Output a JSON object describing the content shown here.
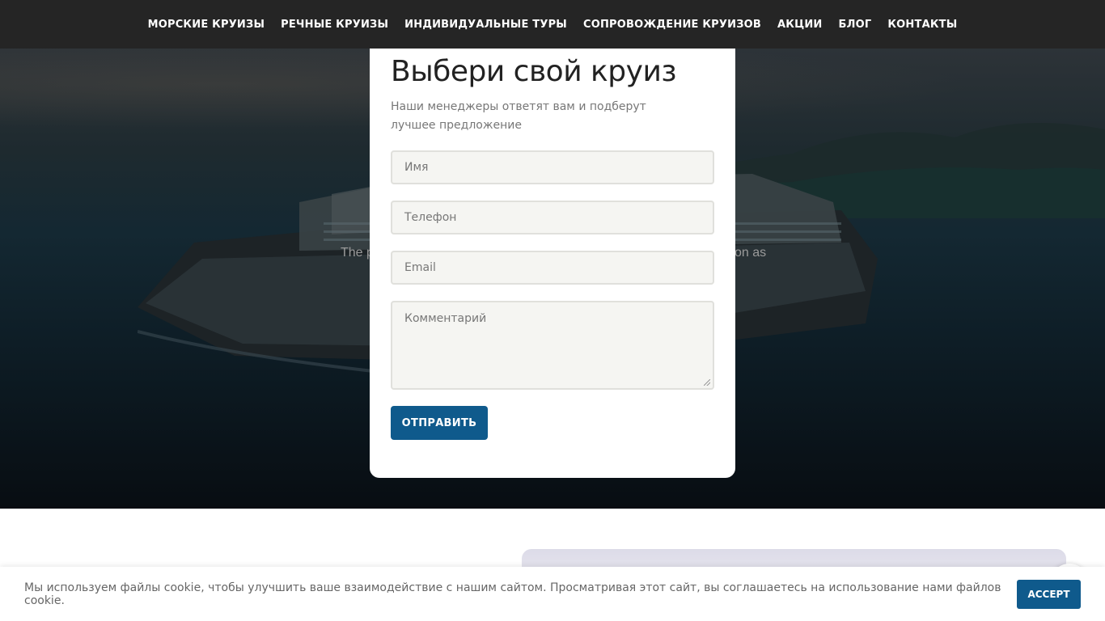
{
  "nav": {
    "items": [
      "МОРСКИЕ КРУИЗЫ",
      "РЕЧНЫЕ КРУИЗЫ",
      "ИНДИВИДУАЛЬНЫЕ ТУРЫ",
      "СОПРОВОЖДЕНИЕ КРУИЗОВ",
      "АКЦИИ",
      "БЛОГ",
      "КОНТАКТЫ"
    ]
  },
  "hero": {
    "text_left": "The p",
    "text_right": "on as"
  },
  "form": {
    "title": "Выбери свой круиз",
    "subtitle": "Наши менеджеры ответят вам и подберут лучшее предложение",
    "name_placeholder": "Имя",
    "phone_placeholder": "Телефон",
    "email_placeholder": "Email",
    "comment_placeholder": "Комментарий",
    "submit_label": "ОТПРАВИТЬ"
  },
  "cookie": {
    "message": "Мы используем файлы cookie, чтобы улучшить ваше взаимодействие с нашим сайтом. Просматривая этот сайт, вы соглашаетесь на использование нами файлов cookie.",
    "accept_label": "ACCEPT"
  },
  "colors": {
    "accent": "#0f5a8c",
    "nav_bg": "#252525"
  }
}
